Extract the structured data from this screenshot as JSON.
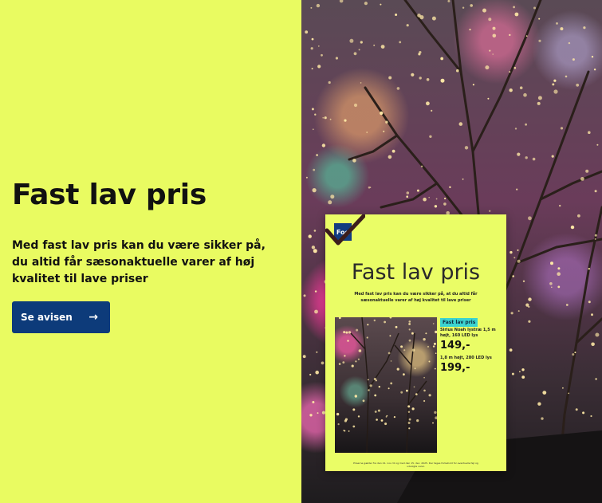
{
  "hero": {
    "headline": "Fast lav pris",
    "lede": "Med fast lav pris kan du være sikker på, du altid får sæsonaktuelle varer af høj kvalitet til lave priser",
    "cta_label": "Se avisen",
    "cta_icon": "arrow-right-icon"
  },
  "flyer": {
    "logo": "Fog",
    "title": "Fast lav pris",
    "subtitle": "Med fast lav pris kan du være sikker på, at du altid får sæsonaktuelle varer af høj kvalitet til lave priser",
    "tag": "Fast lav pris",
    "product_name": "Sirius Noah lystræ 1,5 m højt, 160 LED lys",
    "price_1": "149,-",
    "product_variant": "1,8 m højt, 280 LED lys",
    "price_2": "199,-",
    "fineprint": "Priserne gælder fra den 21. nov. til og med den 15. dec. 2025. Der tages forbehold for eventuelle fejl og udsolgte varer."
  },
  "colors": {
    "background": "#e9fb61",
    "cta_background": "#0d3b7a",
    "text": "#111111",
    "tag": "#3bd3d0"
  }
}
